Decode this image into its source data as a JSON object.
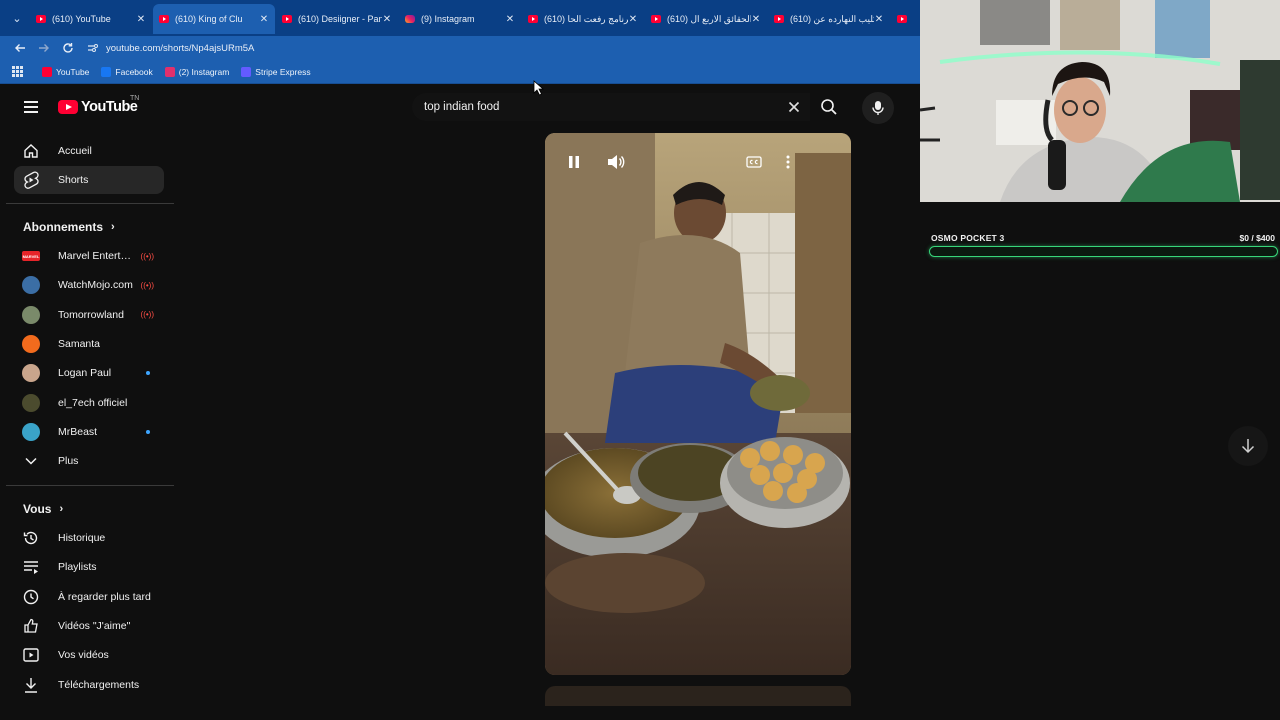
{
  "browser": {
    "tabs": [
      {
        "title": "(610) YouTube",
        "icon": "youtube-icon",
        "active": false
      },
      {
        "title": "(610) King of Clu",
        "icon": "youtube-icon",
        "active": true
      },
      {
        "title": "(610) Desiigner - Pan",
        "icon": "youtube-icon",
        "active": false
      },
      {
        "title": "(9) Instagram",
        "icon": "instagram-icon",
        "active": false
      },
      {
        "title": "(610) برنامج رفعت الحا",
        "icon": "youtube-icon",
        "active": false
      },
      {
        "title": "(610) الحقائق الاربع ال",
        "icon": "youtube-icon",
        "active": false
      },
      {
        "title": "(610) كليب النهارده عن",
        "icon": "youtube-icon",
        "active": false
      }
    ],
    "url": "youtube.com/shorts/Np4ajsURm5A",
    "bookmarks": [
      {
        "label": "YouTube",
        "icon": "youtube-icon",
        "color": "#ff0033"
      },
      {
        "label": "Facebook",
        "icon": "facebook-icon",
        "color": "#1877f2"
      },
      {
        "label": "(2) Instagram",
        "icon": "instagram-icon",
        "color": "#e1306c"
      },
      {
        "label": "Stripe Express",
        "icon": "stripe-icon",
        "color": "#635bff"
      }
    ]
  },
  "masthead": {
    "logo_text": "YouTube",
    "country_code": "TN",
    "search_value": "top indian food"
  },
  "sidebar": {
    "main": [
      {
        "label": "Accueil",
        "icon": "home-icon"
      },
      {
        "label": "Shorts",
        "icon": "shorts-icon",
        "active": true
      }
    ],
    "subscriptions_title": "Abonnements",
    "subscriptions": [
      {
        "label": "Marvel Entertain...",
        "badge": "live",
        "avatar_text": "MARVEL",
        "avatar_color": "#e62429"
      },
      {
        "label": "WatchMojo.com",
        "badge": "live",
        "avatar_text": "",
        "avatar_color": "#3b6ea5"
      },
      {
        "label": "Tomorrowland",
        "badge": "live",
        "avatar_text": "",
        "avatar_color": "#7a8a6a"
      },
      {
        "label": "Samanta",
        "badge": "",
        "avatar_text": "",
        "avatar_color": "#f26b1d"
      },
      {
        "label": "Logan Paul",
        "badge": "dot",
        "avatar_text": "",
        "avatar_color": "#c9a58c"
      },
      {
        "label": "el_7ech officiel",
        "badge": "",
        "avatar_text": "",
        "avatar_color": "#4b4b2e"
      },
      {
        "label": "MrBeast",
        "badge": "dot",
        "avatar_text": "",
        "avatar_color": "#3aa3c8"
      }
    ],
    "more_label": "Plus",
    "you_title": "Vous",
    "you": [
      {
        "label": "Historique",
        "icon": "history-icon"
      },
      {
        "label": "Playlists",
        "icon": "playlists-icon"
      },
      {
        "label": "À regarder plus tard",
        "icon": "watch-later-icon"
      },
      {
        "label": "Vidéos \"J'aime\"",
        "icon": "like-icon"
      },
      {
        "label": "Vos vidéos",
        "icon": "your-videos-icon"
      },
      {
        "label": "Téléchargements",
        "icon": "download-icon"
      }
    ]
  },
  "overlay": {
    "goal_title": "OSMO POCKET 3",
    "goal_amount": "$0  / $400",
    "goal_progress": 0.0
  }
}
